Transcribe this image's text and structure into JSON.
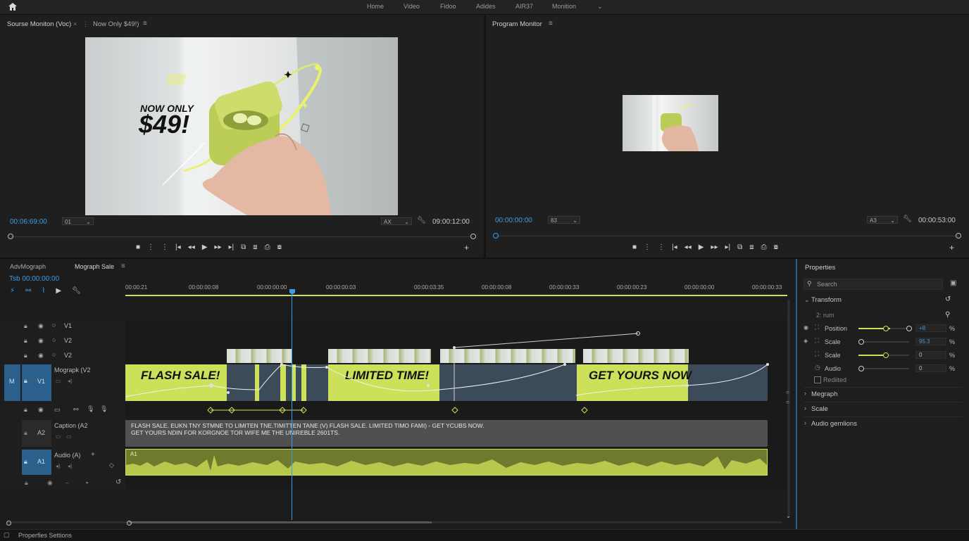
{
  "topbar": {
    "nav": [
      "Home",
      "Video",
      "Fidoo",
      "Adides",
      "AIR37",
      "Monition"
    ]
  },
  "source_monitor": {
    "tab_source": "Sourse Moniton (Voc)",
    "tab_second": "Now Only $49!)",
    "timecode_left": "00:06:69:00",
    "dropdown_left": "01",
    "dropdown_right": "AX",
    "timecode_right": "09:00:12:00",
    "overlay_line1": "NOW ONLY",
    "overlay_line2": "$49!"
  },
  "program_monitor": {
    "title": "Program Monitor",
    "timecode_left": "00:00:00:00",
    "dropdown_left": "83",
    "dropdown_right": "A3",
    "timecode_right": "00:00:53:00"
  },
  "timeline": {
    "tab_first": "AdvMograph",
    "tab_active": "Mograph Sale",
    "playhead_timecode": "Tsb 00:00:00:00",
    "ruler_labels": [
      "00:00:21",
      "00:00:00:08",
      "00:00:00:00",
      "00:00:00:03",
      "00:00:03:35",
      "00:00:00:08",
      "00:00:00:33",
      "00:00:00:23",
      "00:00:00:00",
      "00:00:00:33"
    ],
    "tracks": {
      "v1_top": "V1",
      "v2a": "V2",
      "v2b": "V2",
      "main_name": "Mograpk (V2",
      "main_tag": "V1",
      "main_m": "M",
      "caption_name": "Caption (A2",
      "caption_tag": "A2",
      "audio_name": "Audio (A)",
      "audio_tag": "A1"
    },
    "clips": {
      "flash": "FLASH SALE!",
      "limited": "LIMITED TIME!",
      "get": "GET YOURS NOW",
      "caption_line1": "FLASH SALE. EUKN TNY STMNE TO LIMITEN TNE.TIMITTEN TANE (V) FLASH SALE. LIMITED TIMO FAMI) - GET YCUBS NOW.",
      "caption_line2": "GET YOURS NDIN FOR KORGNOE TOR WIFE ME THE UNIREBLE 2601TS.",
      "audio_label": "A1"
    }
  },
  "properties": {
    "title": "Properties",
    "search_placeholder": "Search",
    "transform": "Transform",
    "sub_label": "2: rum",
    "rows": [
      {
        "label": "Position",
        "value": "+8",
        "unit": "%",
        "level": 0.62
      },
      {
        "label": "Scale",
        "value": "95.3",
        "unit": "%",
        "level": 0.0
      },
      {
        "label": "Scale",
        "value": "0",
        "unit": "%",
        "level": 0.52
      },
      {
        "label": "Audio",
        "value": "0",
        "unit": "%",
        "level": 0.0
      }
    ],
    "checkbox_label": "Rediited",
    "sections": [
      "Megraph",
      "Scale",
      "Audio gemlions"
    ]
  },
  "status": {
    "text": "Properfies Settions"
  },
  "colors": {
    "accent_green": "#cde05a",
    "accent_blue": "#3b9ce6",
    "track_blue": "#2b5f8c"
  }
}
